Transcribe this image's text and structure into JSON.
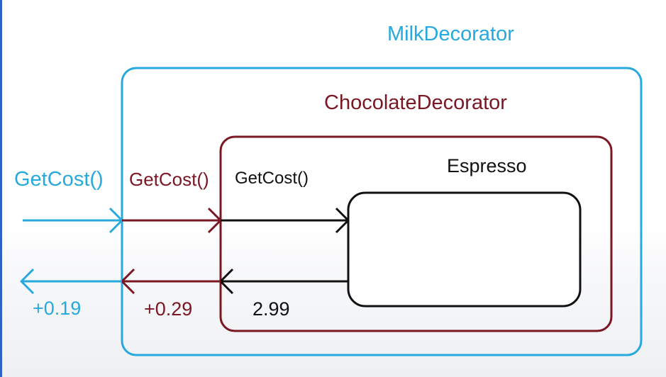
{
  "decorators": {
    "milk": {
      "title": "MilkDecorator",
      "call": "GetCost()",
      "return_value": "+0.19",
      "color": "#27a9dd"
    },
    "chocolate": {
      "title": "ChocolateDecorator",
      "call": "GetCost()",
      "return_value": "+0.29",
      "color": "#7a1722"
    },
    "espresso": {
      "title": "Espresso",
      "call": "GetCost()",
      "return_value": "2.99",
      "color": "#111111"
    }
  }
}
